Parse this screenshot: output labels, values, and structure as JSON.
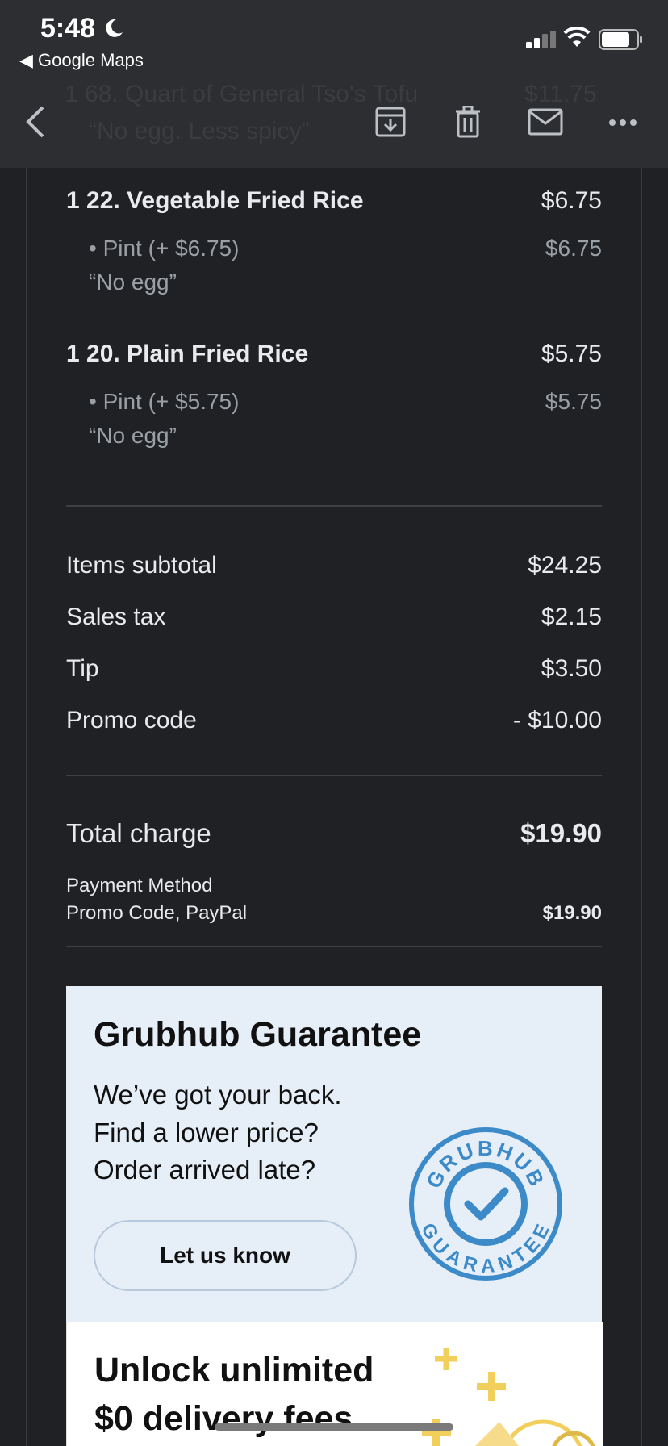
{
  "status_bar": {
    "time": "5:48",
    "back_app": "◀ Google Maps"
  },
  "toolbar": {
    "ghost_item_line1": "1 68. Quart of General Tso's Tofu",
    "ghost_item_price": "$11.75",
    "ghost_item_line2": "“No egg. Less spicy”",
    "icons": [
      "back-icon",
      "archive-icon",
      "trash-icon",
      "mail-icon",
      "more-icon"
    ]
  },
  "order": {
    "items": [
      {
        "name": "1 22. Vegetable Fried Rice",
        "price": "$6.75",
        "option": "• Pint (+ $6.75)",
        "option_price": "$6.75",
        "note": "“No egg”"
      },
      {
        "name": "1 20. Plain Fried Rice",
        "price": "$5.75",
        "option": "• Pint (+ $5.75)",
        "option_price": "$5.75",
        "note": "“No egg”"
      }
    ],
    "summary": {
      "subtotal_label": "Items subtotal",
      "subtotal": "$24.25",
      "tax_label": "Sales tax",
      "tax": "$2.15",
      "tip_label": "Tip",
      "tip": "$3.50",
      "promo_label": "Promo code",
      "promo": "- $10.00",
      "total_label": "Total charge",
      "total": "$19.90",
      "payment_method_label": "Payment Method",
      "payment_method": "Promo Code, PayPal",
      "payment_amount": "$19.90"
    }
  },
  "guarantee": {
    "title": "Grubhub Guarantee",
    "line1": "We’ve got your back.",
    "line2": "Find a lower price?",
    "line3": "Order arrived late?",
    "button": "Let us know",
    "badge_top": "GRUBHUB",
    "badge_bottom": "GUARANTEE",
    "badge_color": "#3d8ac9"
  },
  "promo_card": {
    "line1": "Unlock unlimited",
    "line2": "$0 delivery fees",
    "accent": "#f2cf5b"
  }
}
